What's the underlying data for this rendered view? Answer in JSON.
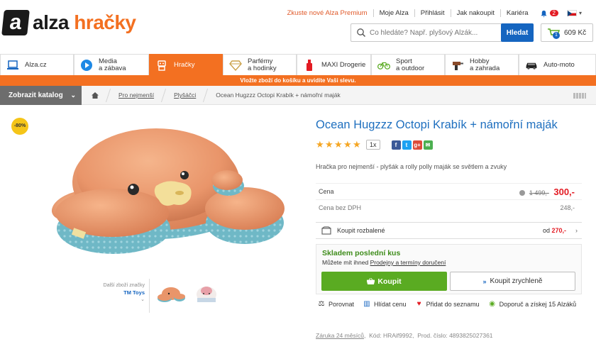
{
  "header": {
    "logo_letter": "a",
    "logo_word1": "alza",
    "logo_word2": "hračky",
    "links": [
      "Zkuste nové Alza Premium",
      "Moje Alza",
      "Přihlásit",
      "Jak nakoupit",
      "Kariéra"
    ],
    "notifications": "2",
    "search_placeholder": "Co hledáte? Např. plyšový Alzák...",
    "search_button": "Hledat",
    "cart_count": "1",
    "cart_total": "609 Kč"
  },
  "nav": [
    {
      "label": "Alza.cz",
      "icon": "laptop-icon"
    },
    {
      "label": "Media\na zábava",
      "icon": "play-icon"
    },
    {
      "label": "Hračky",
      "icon": "robot-icon"
    },
    {
      "label": "Parfémy\na hodinky",
      "icon": "diamond-icon"
    },
    {
      "label": "MAXI Drogerie",
      "icon": "bottle-icon"
    },
    {
      "label": "Sport\na outdoor",
      "icon": "bike-icon"
    },
    {
      "label": "Hobby\na zahrada",
      "icon": "drill-icon"
    },
    {
      "label": "Auto-moto",
      "icon": "car-icon"
    }
  ],
  "banner": "Vložte zboží do košíku a uvidíte Vaši slevu.",
  "breadcrumb": {
    "catalog_button": "Zobrazit katalog",
    "items": [
      "Pro nejmenší",
      "Plyšáčci",
      "Ocean Hugzzz Octopi Krabík + námořní maják"
    ]
  },
  "gallery": {
    "discount": "-80%",
    "brand_label": "Další zboží značky",
    "brand_name": "TM Toys"
  },
  "product": {
    "title": "Ocean Hugzzz Octopi Krabík + námořní maják",
    "rating_stars": 5,
    "review_count": "1x",
    "description": "Hračka pro nejmenší - plyšák a rolly polly maják se světlem a zvuky",
    "price_label": "Cena",
    "old_price": "1 499,-",
    "price": "300,-",
    "price_novat_label": "Cena bez DPH",
    "price_novat": "248,-",
    "unboxed_label": "Koupit rozbalené",
    "unboxed_from": "od",
    "unboxed_price": "270,-",
    "stock": "Skladem poslední kus",
    "stock_note": "Můžete mít ihned",
    "stock_link": "Prodejny a termíny doručení",
    "buy_button": "Koupit",
    "quick_button": "Koupit zrychleně",
    "actions": [
      "Porovnat",
      "Hlídat cenu",
      "Přidat do seznamu",
      "Doporuč a získej 15 Alzáků"
    ],
    "footer_warranty": "Záruka 24 měsíců",
    "footer_code": "Kód: HRAif9992,",
    "footer_partno": "Prod. číslo: 4893825027361"
  },
  "colors": {
    "brand_orange": "#f37021",
    "link_blue": "#1e6fbf",
    "buy_green": "#5aab22",
    "price_red": "#e31b23"
  }
}
